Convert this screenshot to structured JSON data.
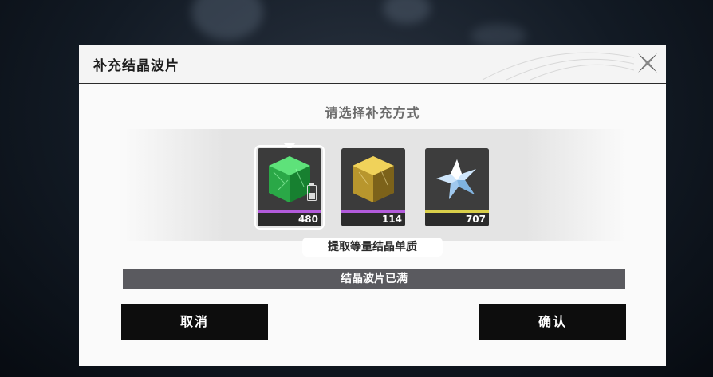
{
  "dialog": {
    "title": "补充结晶波片",
    "close_icon": "close-x-icon"
  },
  "prompt": "请选择补充方式",
  "items": [
    {
      "name": "green-crystal-cube",
      "count": "480",
      "selected": true,
      "bar_color": "#b25bdb",
      "accent": "#3bd15a",
      "icon": "battery-icon"
    },
    {
      "name": "gold-crystal-cube",
      "count": "114",
      "selected": false,
      "bar_color": "#b25bdb",
      "accent": "#d9b334"
    },
    {
      "name": "blue-crystal-star",
      "count": "707",
      "selected": false,
      "bar_color": "#d9cf4a",
      "accent": "#8fc3ef"
    }
  ],
  "selected_description": "提取等量结晶单质",
  "status_text": "结晶波片已满",
  "buttons": {
    "cancel": "取消",
    "confirm": "确认"
  }
}
